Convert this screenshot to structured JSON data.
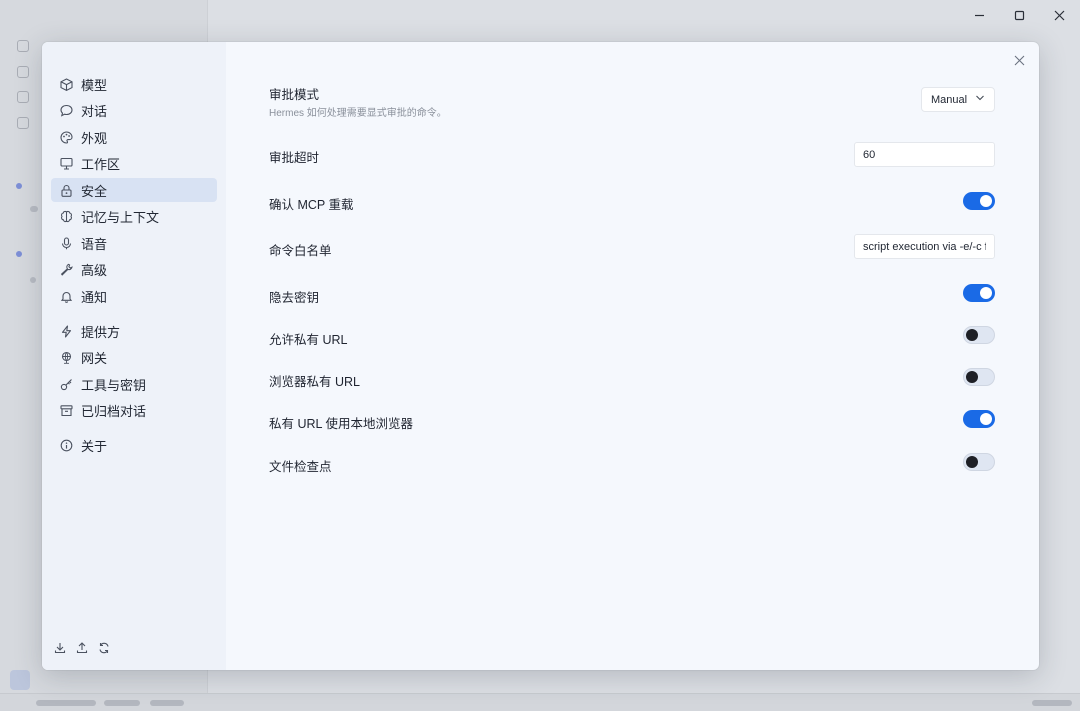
{
  "window": {
    "controls": [
      "minimize",
      "maximize",
      "close"
    ]
  },
  "settings_nav": {
    "groups": [
      [
        {
          "label": "模型",
          "icon": "cube-icon"
        },
        {
          "label": "对话",
          "icon": "chat-bubble-icon"
        },
        {
          "label": "外观",
          "icon": "palette-icon"
        },
        {
          "label": "工作区",
          "icon": "monitor-icon"
        },
        {
          "label": "安全",
          "icon": "lock-icon",
          "active": true
        },
        {
          "label": "记忆与上下文",
          "icon": "brain-icon"
        },
        {
          "label": "语音",
          "icon": "microphone-icon"
        },
        {
          "label": "高级",
          "icon": "wrench-icon"
        },
        {
          "label": "通知",
          "icon": "bell-icon"
        }
      ],
      [
        {
          "label": "提供方",
          "icon": "lightning-icon"
        },
        {
          "label": "网关",
          "icon": "globe-icon"
        },
        {
          "label": "工具与密钥",
          "icon": "key-icon"
        },
        {
          "label": "已归档对话",
          "icon": "archive-icon"
        }
      ],
      [
        {
          "label": "关于",
          "icon": "info-icon"
        }
      ]
    ],
    "footer_icons": [
      "download-icon",
      "upload-icon",
      "refresh-icon"
    ]
  },
  "security": {
    "approval_mode": {
      "title": "审批模式",
      "description": "Hermes 如何处理需要显式审批的命令。",
      "selected": "Manual"
    },
    "approval_timeout": {
      "title": "审批超时",
      "value": "60"
    },
    "confirm_mcp_reload": {
      "title": "确认 MCP 重载",
      "enabled": true
    },
    "command_allowlist": {
      "title": "命令白名单",
      "value": "script execution via -e/-c fl"
    },
    "redact_secrets": {
      "title": "隐去密钥",
      "enabled": true
    },
    "allow_private_urls": {
      "title": "允许私有 URL",
      "enabled": false
    },
    "browser_private_urls": {
      "title": "浏览器私有 URL",
      "enabled": false
    },
    "private_url_local_browser": {
      "title": "私有 URL 使用本地浏览器",
      "enabled": true
    },
    "file_checkpoints": {
      "title": "文件检查点",
      "enabled": false
    }
  },
  "colors": {
    "accent": "#1a6ae6",
    "active_nav_bg": "#d8e2f3",
    "modal_bg": "#f5f8fd"
  }
}
